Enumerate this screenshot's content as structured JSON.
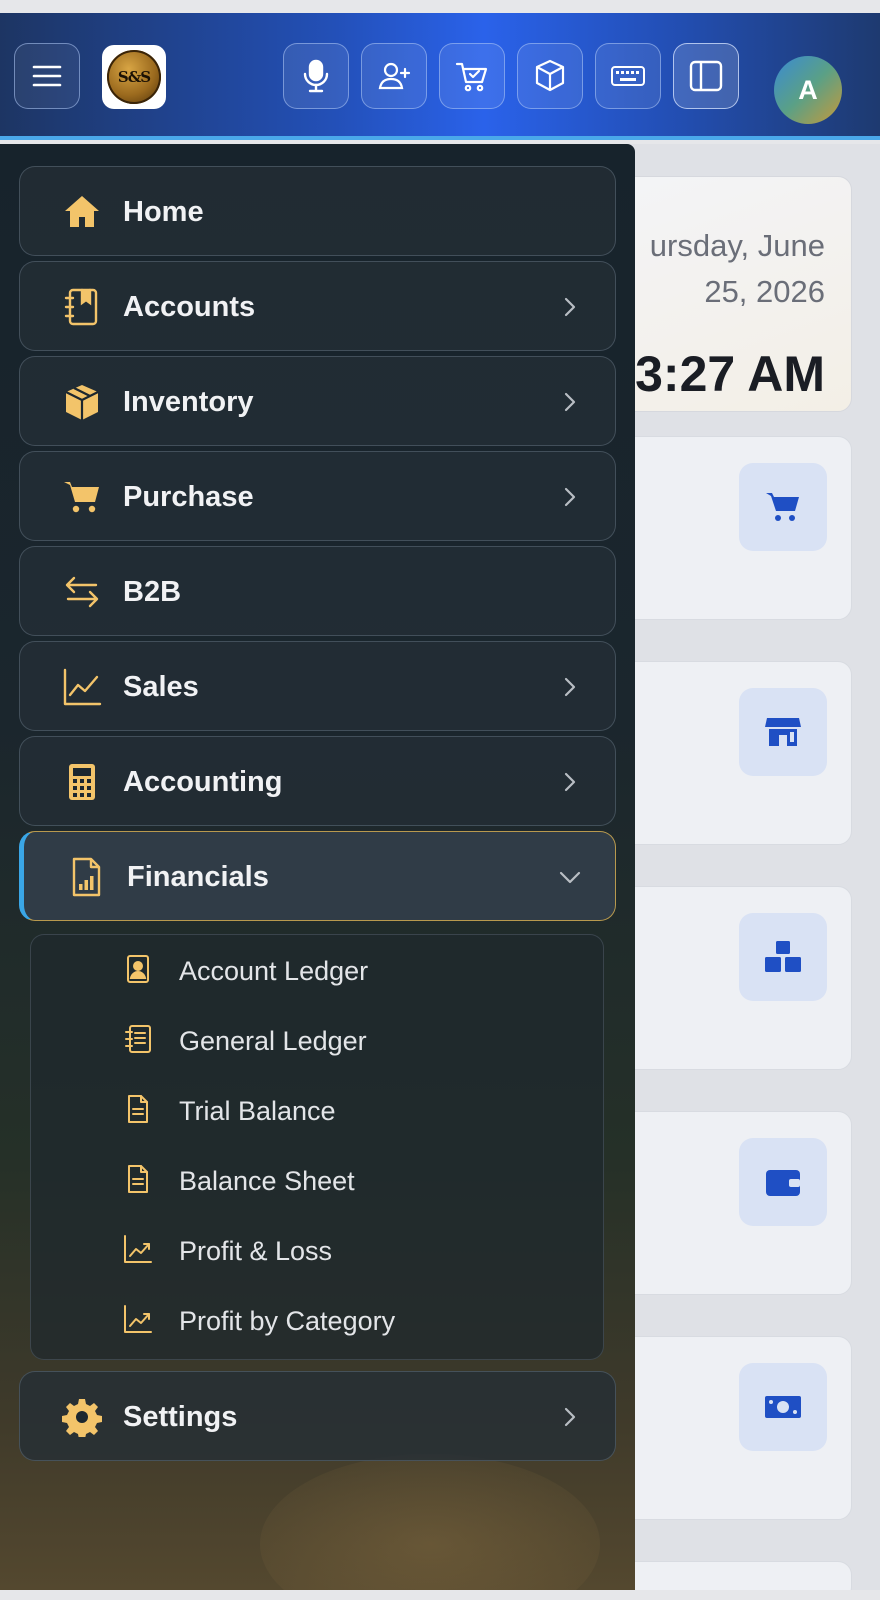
{
  "header": {
    "menu_button": {
      "icon": "hamburger-icon"
    },
    "logo": {
      "text": "S&S"
    },
    "actions": [
      {
        "name": "microphone",
        "icon": "microphone-icon"
      },
      {
        "name": "add-user",
        "icon": "user-plus-icon"
      },
      {
        "name": "cart",
        "icon": "cart-check-icon"
      },
      {
        "name": "box",
        "icon": "box-icon"
      },
      {
        "name": "keyboard",
        "icon": "keyboard-icon"
      },
      {
        "name": "sidebar-toggle",
        "icon": "sidebar-panel-icon"
      }
    ],
    "avatar_initial": "A",
    "colors": {
      "accent_border": "#4aa8ea",
      "gradient_mid": "#2a62ea"
    }
  },
  "dashboard": {
    "date_line1": "ursday, June",
    "date_line2": "25, 2026",
    "time": "3:27 AM",
    "card_icons": [
      "cart-icon",
      "store-icon",
      "boxes-icon",
      "wallet-icon",
      "money-icon"
    ]
  },
  "sidebar": {
    "items": [
      {
        "label": "Home",
        "icon": "home-icon",
        "has_chevron": false
      },
      {
        "label": "Accounts",
        "icon": "address-book-icon",
        "has_chevron": true
      },
      {
        "label": "Inventory",
        "icon": "box-icon",
        "has_chevron": true
      },
      {
        "label": "Purchase",
        "icon": "cart-icon",
        "has_chevron": true
      },
      {
        "label": "B2B",
        "icon": "arrows-exchange-icon",
        "has_chevron": false
      },
      {
        "label": "Sales",
        "icon": "line-chart-icon",
        "has_chevron": true
      },
      {
        "label": "Accounting",
        "icon": "calculator-icon",
        "has_chevron": true
      },
      {
        "label": "Financials",
        "icon": "report-chart-icon",
        "has_chevron": true,
        "expanded": true
      },
      {
        "label": "Settings",
        "icon": "gear-icon",
        "has_chevron": true
      }
    ],
    "financials_submenu": [
      {
        "label": "Account Ledger",
        "icon": "person-card-icon"
      },
      {
        "label": "General Ledger",
        "icon": "ledger-list-icon"
      },
      {
        "label": "Trial Balance",
        "icon": "document-icon"
      },
      {
        "label": "Balance Sheet",
        "icon": "document-icon"
      },
      {
        "label": "Profit & Loss",
        "icon": "trend-chart-icon"
      },
      {
        "label": "Profit by Category",
        "icon": "trend-chart-icon"
      }
    ],
    "colors": {
      "icon_gold": "#f3c46a",
      "active_left_border": "#3aa6e6",
      "active_border": "#b8994e"
    }
  }
}
